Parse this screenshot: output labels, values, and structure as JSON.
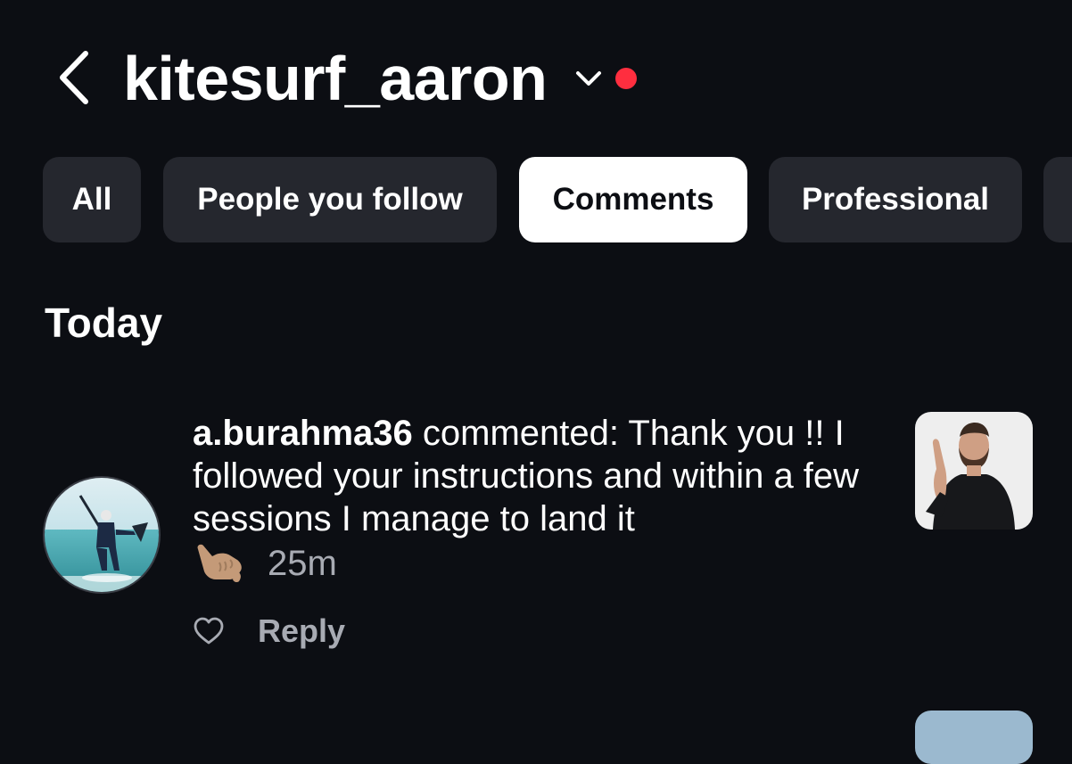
{
  "header": {
    "title": "kitesurf_aaron",
    "icons": {
      "back": "chevron-left-icon",
      "account_switch": "chevron-down-icon",
      "unread": "red-dot"
    },
    "colors": {
      "background": "#0c0e13",
      "unread_dot": "#ff2e3f"
    }
  },
  "filters": {
    "chips": [
      {
        "label": "All",
        "active": false
      },
      {
        "label": "People you follow",
        "active": false
      },
      {
        "label": "Comments",
        "active": true
      },
      {
        "label": "Professional",
        "active": false
      }
    ],
    "colors": {
      "chip_bg": "#25272e",
      "chip_active_bg": "#ffffff"
    }
  },
  "sections": [
    {
      "title": "Today",
      "notifications": [
        {
          "username": "a.burahma36",
          "action": " commented: ",
          "comment_text": "Thank you !! I followed your instructions and within a few sessions I manage to land it",
          "emoji": "call-me-hand-emoji",
          "time": "25m",
          "reply_label": "Reply",
          "icons": {
            "like": "heart-outline-icon"
          }
        }
      ]
    }
  ]
}
